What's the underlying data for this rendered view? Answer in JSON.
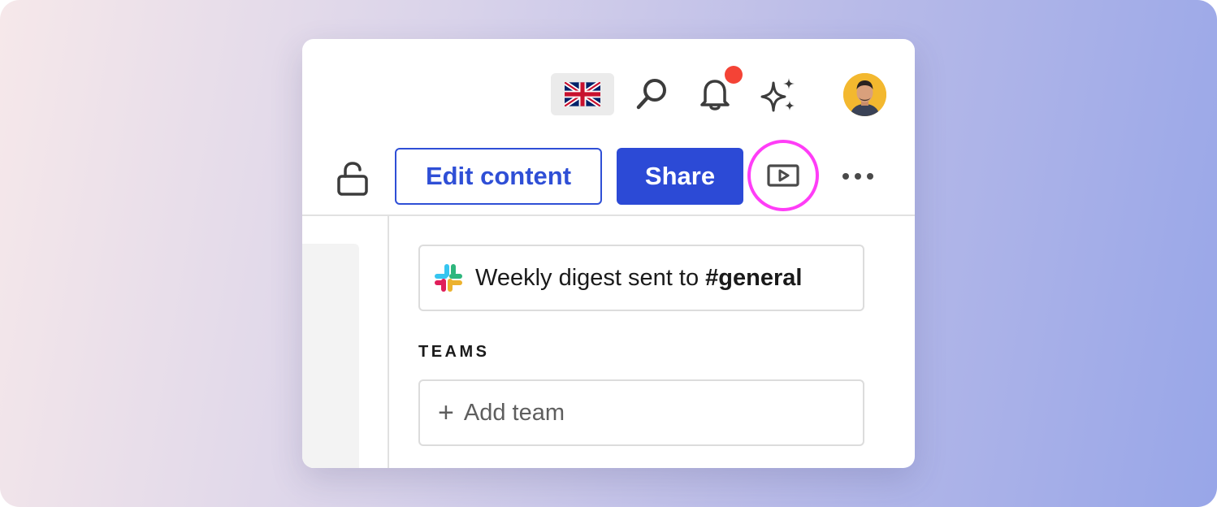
{
  "topbar": {
    "language_icon": "uk-flag-icon",
    "search_icon": "search-icon",
    "notifications_icon": "bell-icon",
    "notification_dot_color": "#f44336",
    "ai_icon": "sparkles-icon",
    "avatar_icon": "user-avatar"
  },
  "actions": {
    "lock_icon": "lock-open-icon",
    "edit_label": "Edit content",
    "share_label": "Share",
    "present_icon": "present-play-icon",
    "more_icon": "more-horizontal-icon",
    "highlight_color": "#ff3df7",
    "accent_color": "#2c4ad6"
  },
  "digest": {
    "icon": "slack-icon",
    "text": "Weekly digest sent to ",
    "channel": "#general"
  },
  "teams": {
    "heading": "TEAMS",
    "add_label": "Add team",
    "add_icon": "plus-icon"
  }
}
